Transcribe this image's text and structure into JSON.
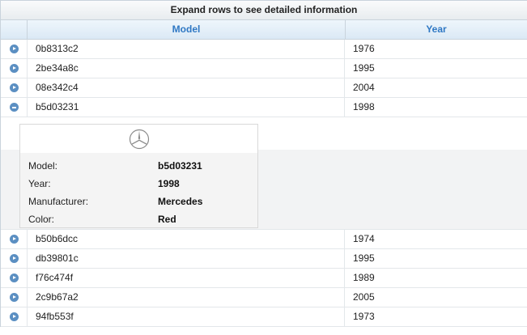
{
  "caption": "Expand rows to see detailed information",
  "columns": {
    "model": "Model",
    "year": "Year"
  },
  "rows_before": [
    {
      "model": "0b8313c2",
      "year": "1976"
    },
    {
      "model": "2be34a8c",
      "year": "1995"
    },
    {
      "model": "08e342c4",
      "year": "2004"
    }
  ],
  "expanded_row": {
    "model": "b5d03231",
    "year": "1998"
  },
  "detail": {
    "logo": "mercedes-logo-icon",
    "fields": [
      {
        "label": "Model:",
        "value": "b5d03231"
      },
      {
        "label": "Year:",
        "value": "1998"
      },
      {
        "label": "Manufacturer:",
        "value": "Mercedes"
      },
      {
        "label": "Color:",
        "value": "Red"
      }
    ]
  },
  "rows_after": [
    {
      "model": "b50b6dcc",
      "year": "1974"
    },
    {
      "model": "db39801c",
      "year": "1995"
    },
    {
      "model": "f76c474f",
      "year": "1989"
    },
    {
      "model": "2c9b67a2",
      "year": "2005"
    },
    {
      "model": "94fb553f",
      "year": "1973"
    }
  ],
  "colors": {
    "header_text": "#2f78c4",
    "toggle": "#5b8fc2"
  }
}
